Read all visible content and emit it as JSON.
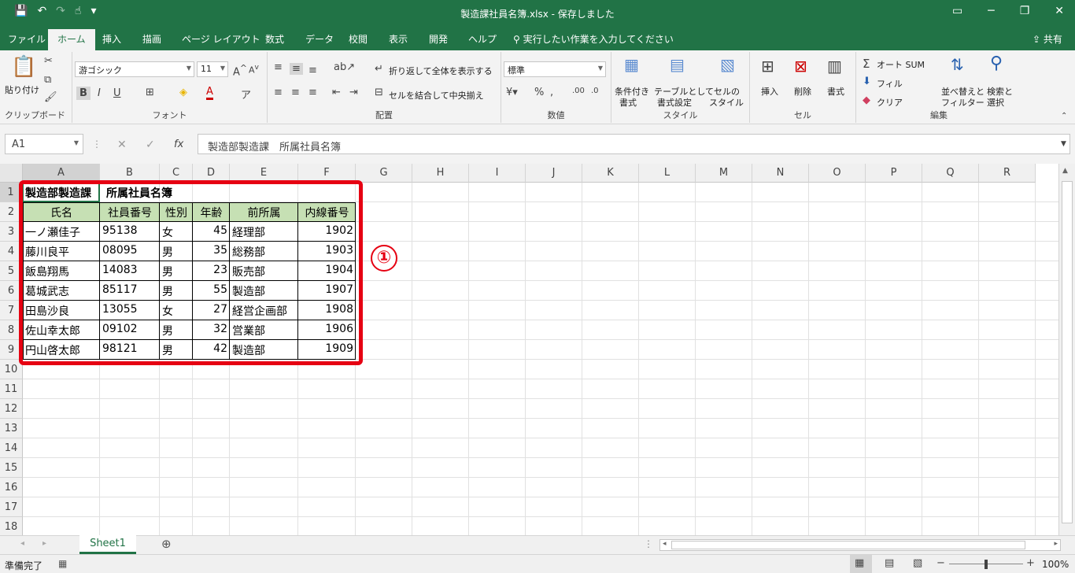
{
  "window": {
    "title": "製造課社員名簿.xlsx  -  保存しました",
    "share": "共有"
  },
  "tabs": [
    "ファイル",
    "ホーム",
    "挿入",
    "描画",
    "ページ レイアウト",
    "数式",
    "データ",
    "校閲",
    "表示",
    "開発",
    "ヘルプ"
  ],
  "tell_me": "実行したい作業を入力してください",
  "ribbon": {
    "clipboard": {
      "paste": "貼り付け",
      "label": "クリップボード"
    },
    "font": {
      "name": "游ゴシック",
      "size": "11",
      "label": "フォント",
      "bold": "B",
      "italic": "I",
      "underline": "U"
    },
    "alignment": {
      "wrap": "折り返して全体を表示する",
      "merge": "セルを結合して中央揃え",
      "label": "配置"
    },
    "number": {
      "format": "標準",
      "label": "数値",
      "percent": "%"
    },
    "styles": {
      "conditional": "条件付き",
      "conditional2": "書式",
      "table": "テーブルとして",
      "table2": "書式設定",
      "cell": "セルの",
      "cell2": "スタイル",
      "label": "スタイル"
    },
    "cells": {
      "insert": "挿入",
      "delete": "削除",
      "format": "書式",
      "label": "セル"
    },
    "editing": {
      "autosum": "オート SUM",
      "fill": "フィル",
      "clear": "クリア",
      "sort": "並べ替えと",
      "sort2": "フィルター",
      "find": "検索と",
      "find2": "選択",
      "label": "編集"
    }
  },
  "formula_bar": {
    "name_box": "A1",
    "fx": "fx",
    "content": "製造部製造課　所属社員名簿"
  },
  "grid": {
    "columns": [
      "A",
      "B",
      "C",
      "D",
      "E",
      "F",
      "G",
      "H",
      "I",
      "J",
      "K",
      "L",
      "M",
      "N",
      "O",
      "P",
      "Q",
      "R"
    ],
    "rows": [
      "1",
      "2",
      "3",
      "4",
      "5",
      "6",
      "7",
      "8",
      "9",
      "10",
      "11",
      "12",
      "13",
      "14",
      "15",
      "16",
      "17",
      "18"
    ],
    "title_a1": "製造部製造課",
    "title_b1": "所属社員名簿",
    "headers": [
      "氏名",
      "社員番号",
      "性別",
      "年齢",
      "前所属",
      "内線番号"
    ],
    "data": [
      [
        "一ノ瀬佳子",
        "95138",
        "女",
        "45",
        "経理部",
        "1902"
      ],
      [
        "藤川良平",
        "08095",
        "男",
        "35",
        "総務部",
        "1903"
      ],
      [
        "飯島翔馬",
        "14083",
        "男",
        "23",
        "販売部",
        "1904"
      ],
      [
        "葛城武志",
        "85117",
        "男",
        "55",
        "製造部",
        "1907"
      ],
      [
        "田島沙良",
        "13055",
        "女",
        "27",
        "経営企画部",
        "1908"
      ],
      [
        "佐山幸太郎",
        "09102",
        "男",
        "32",
        "営業部",
        "1906"
      ],
      [
        "円山啓太郎",
        "98121",
        "男",
        "42",
        "製造部",
        "1909"
      ]
    ]
  },
  "annotation": {
    "badge": "①",
    "color": "#e60012"
  },
  "sheet": {
    "tab": "Sheet1"
  },
  "status": {
    "ready": "準備完了",
    "zoom": "100%"
  },
  "colors": {
    "excel_green": "#217346",
    "header_fill": "#c6e0b4"
  }
}
